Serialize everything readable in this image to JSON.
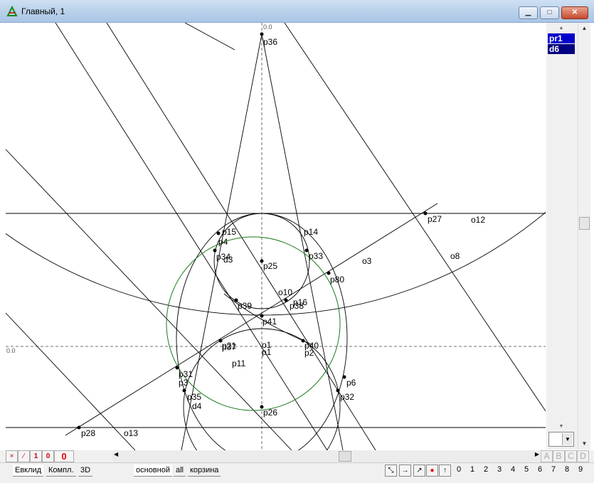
{
  "window": {
    "title": "Главный, 1",
    "minimize_label": "▁",
    "maximize_label": "□",
    "close_label": "✕"
  },
  "layers": [
    "pr1",
    "d6"
  ],
  "colors": {
    "green_circle": "#1a7a1a",
    "selected_layer": "#0000cc",
    "layer2_bg": "#000080"
  },
  "canvas": {
    "axis_zero_top": "0.0",
    "axis_zero_left": "0.0",
    "point_labels": [
      "p36",
      "p15",
      "p4",
      "p14",
      "p34",
      "d3",
      "p25",
      "p33",
      "p80",
      "p27",
      "o12",
      "o3",
      "o8",
      "p39",
      "o10",
      "p16",
      "p41",
      "p38",
      "o1",
      "p1",
      "p37",
      "p40",
      "p2",
      "p21",
      "p11",
      "p31",
      "p3",
      "p6",
      "p35",
      "p32",
      "d4",
      "p26",
      "p28",
      "o13"
    ]
  },
  "bottom_toolbar": {
    "btn_x": "×",
    "btn_slash": "⁄",
    "btn_1": "1",
    "btn_0": "0",
    "counter": "0",
    "letters": [
      "A",
      "B",
      "C",
      "D"
    ]
  },
  "tabs": {
    "left": [
      "Евклид",
      "Компл.",
      "3D"
    ],
    "right": [
      "основной",
      "all",
      "корзина"
    ]
  },
  "digits": [
    "0",
    "1",
    "2",
    "3",
    "4",
    "5",
    "6",
    "7",
    "8",
    "9"
  ]
}
